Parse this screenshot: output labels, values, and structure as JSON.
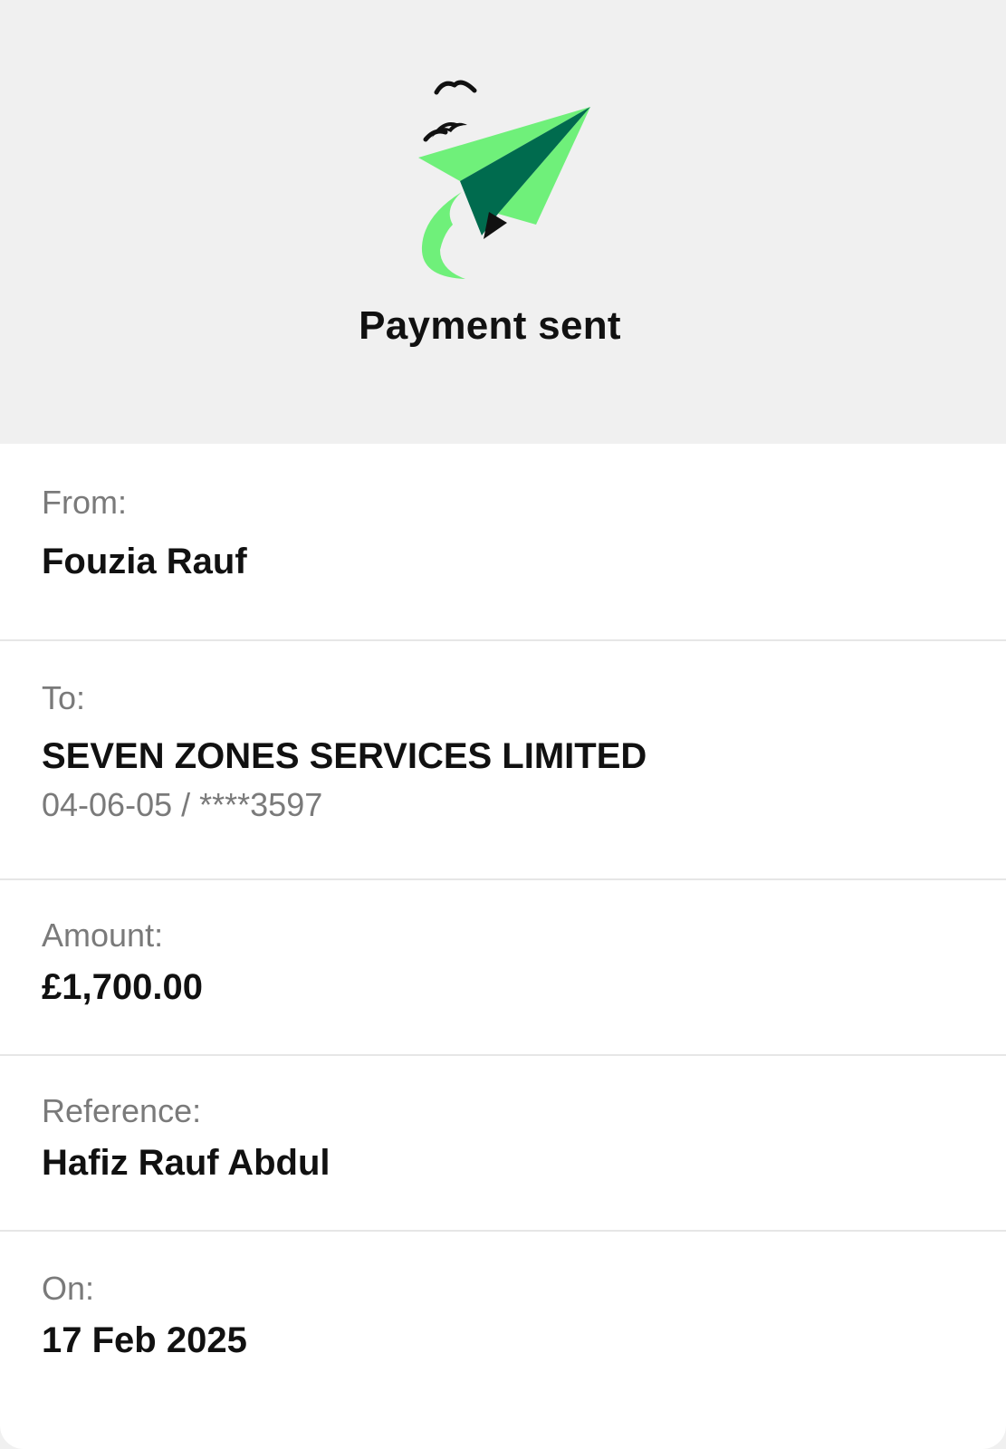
{
  "header": {
    "title": "Payment sent",
    "illustration": "paper-plane-with-birds-icon",
    "colors": {
      "background": "#f0f0f0",
      "plane_light": "#6ff07a",
      "plane_dark": "#006b4e",
      "plane_black": "#111111"
    }
  },
  "details": {
    "from": {
      "label": "From:",
      "value": "Fouzia Rauf"
    },
    "to": {
      "label": "To:",
      "value": "SEVEN ZONES SERVICES LIMITED",
      "account": "04-06-05 / ****3597"
    },
    "amount": {
      "label": "Amount:",
      "value": "£1,700.00"
    },
    "reference": {
      "label": "Reference:",
      "value": "Hafiz Rauf Abdul"
    },
    "on": {
      "label": "On:",
      "value": "17 Feb 2025"
    }
  }
}
